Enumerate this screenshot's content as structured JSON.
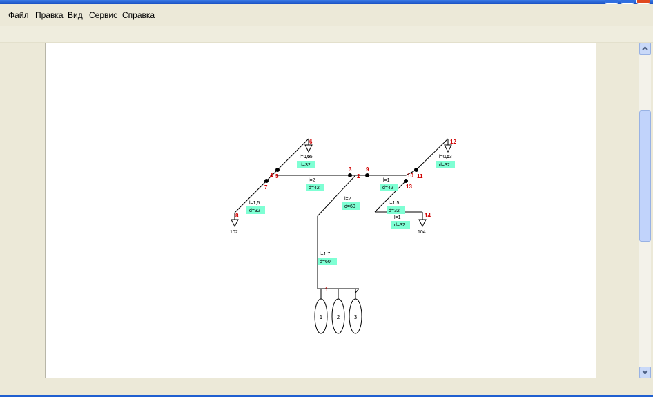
{
  "menu": {
    "items": [
      {
        "label": "Файл"
      },
      {
        "label": "Правка"
      },
      {
        "label": "Вид"
      },
      {
        "label": "Сервис"
      },
      {
        "label": "Справка"
      }
    ]
  },
  "diagram": {
    "node_labels": {
      "n1": "1",
      "n2": "2",
      "n3": "3",
      "n4": "4",
      "n5": "5",
      "n6": "6",
      "n7": "7",
      "n8": "8",
      "n9": "9",
      "n10": "10",
      "n11": "11",
      "n12": "12",
      "n13": "13",
      "n14": "14"
    },
    "fixture_labels": {
      "f102": "102",
      "f104": "104",
      "f105": "105",
      "f103": "103"
    },
    "segments": {
      "s5_6": {
        "length": "l=0,5",
        "diameter": "d=32"
      },
      "s5_3": {
        "length": "l=2",
        "diameter": "d=42"
      },
      "s4_8": {
        "length": "l=1,5",
        "diameter": "d=32"
      },
      "s2_10": {
        "length": "l=1",
        "diameter": "d=42"
      },
      "s11_12": {
        "length": "l=0,5",
        "diameter": "d=32"
      },
      "s2_low": {
        "length": "l=2",
        "diameter": "d=60"
      },
      "s13": {
        "length": "l=1,5",
        "diameter": "d=32"
      },
      "s14": {
        "length": "l=1",
        "diameter": "d=32"
      },
      "sriser": {
        "length": "l=1,7",
        "diameter": "d=60"
      }
    },
    "pumps": [
      "1",
      "2",
      "3"
    ],
    "colors": {
      "node_label": "#d00000",
      "segment_label_bg": "#7fffd4",
      "line": "#000000"
    }
  },
  "icons": {
    "scroll_up": "chevron-up-icon",
    "scroll_down": "chevron-down-icon"
  }
}
